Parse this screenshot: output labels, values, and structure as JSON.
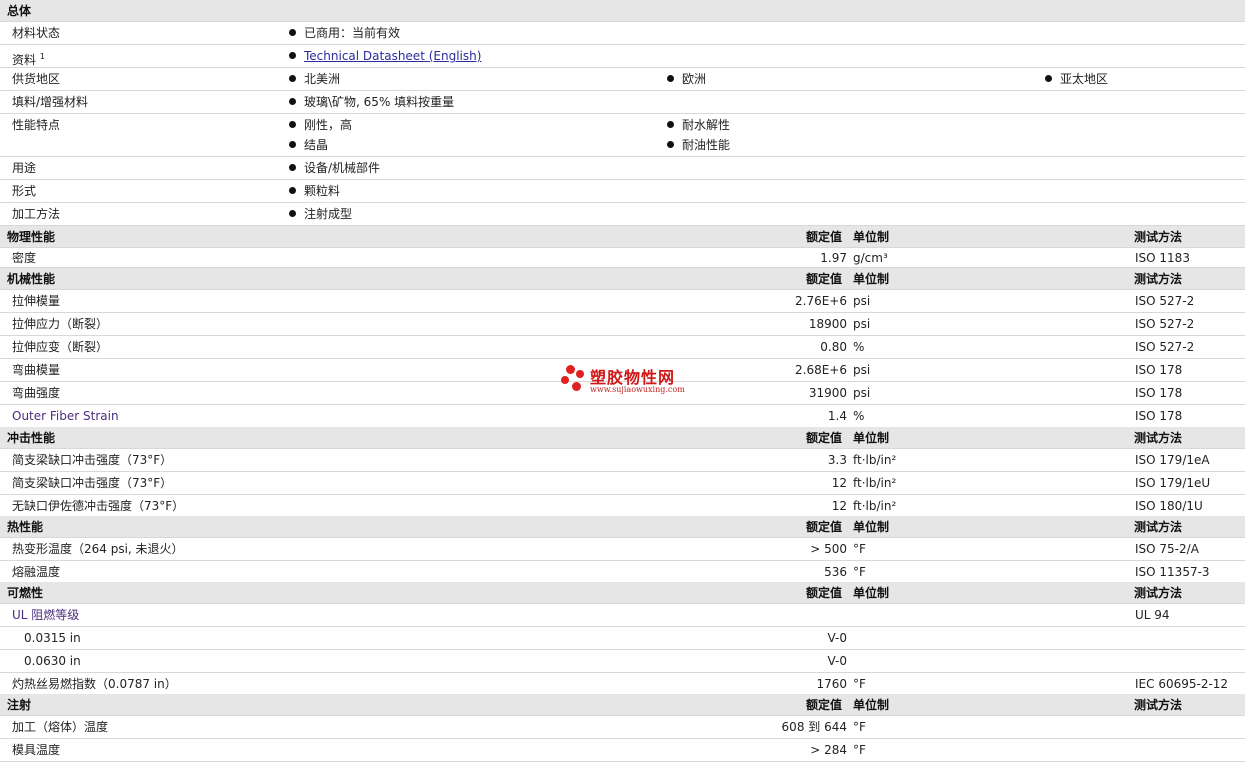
{
  "general": {
    "title": "总体",
    "status_label": "材料状态",
    "status_value": "已商用：当前有效",
    "docs_label": "资料",
    "docs_sup": "1",
    "docs_link": "Technical Datasheet (English)",
    "region_label": "供货地区",
    "regions": [
      "北美洲",
      "欧洲",
      "亚太地区"
    ],
    "filler_label": "填料/增强材料",
    "filler_value": "玻璃\\矿物, 65% 填料按重量",
    "features_label": "性能特点",
    "features": [
      "刚性，高",
      "耐水解性",
      "结晶",
      "耐油性能"
    ],
    "uses_label": "用途",
    "uses_value": "设备/机械部件",
    "form_label": "形式",
    "form_value": "颗粒料",
    "processing_label": "加工方法",
    "processing_value": "注射成型"
  },
  "headers": {
    "nominal": "额定值",
    "unit": "单位制",
    "method": "测试方法"
  },
  "physical": {
    "title": "物理性能",
    "rows": [
      {
        "name": "密度",
        "value": "1.97",
        "unit": "g/cm³",
        "method": "ISO 1183"
      }
    ]
  },
  "mechanical": {
    "title": "机械性能",
    "rows": [
      {
        "name": "拉伸模量",
        "value": "2.76E+6",
        "unit": "psi",
        "method": "ISO 527-2"
      },
      {
        "name": "拉伸应力（断裂）",
        "value": "18900",
        "unit": "psi",
        "method": "ISO 527-2"
      },
      {
        "name": "拉伸应变（断裂）",
        "value": "0.80",
        "unit": "%",
        "method": "ISO 527-2"
      },
      {
        "name": "弯曲模量",
        "value": "2.68E+6",
        "unit": "psi",
        "method": "ISO 178"
      },
      {
        "name": "弯曲强度",
        "value": "31900",
        "unit": "psi",
        "method": "ISO 178"
      },
      {
        "name": "Outer Fiber Strain",
        "value": "1.4",
        "unit": "%",
        "method": "ISO 178"
      }
    ]
  },
  "impact": {
    "title": "冲击性能",
    "rows": [
      {
        "name": "简支梁缺口冲击强度（73°F）",
        "value": "3.3",
        "unit": "ft·lb/in²",
        "method": "ISO 179/1eA"
      },
      {
        "name": "简支梁缺口冲击强度（73°F）",
        "value": "12",
        "unit": "ft·lb/in²",
        "method": "ISO 179/1eU"
      },
      {
        "name": "无缺口伊佐德冲击强度（73°F）",
        "value": "12",
        "unit": "ft·lb/in²",
        "method": "ISO 180/1U"
      }
    ]
  },
  "thermal": {
    "title": "热性能",
    "rows": [
      {
        "name": "热变形温度（264 psi, 未退火）",
        "value": "> 500",
        "unit": "°F",
        "method": "ISO 75-2/A"
      },
      {
        "name": "熔融温度",
        "value": "536",
        "unit": "°F",
        "method": "ISO 11357-3"
      }
    ]
  },
  "flammability": {
    "title": "可燃性",
    "rows": [
      {
        "name": "UL 阻燃等级",
        "value": "",
        "unit": "",
        "method": "UL 94"
      },
      {
        "name": "0.0315 in",
        "value": "V-0",
        "unit": "",
        "method": ""
      },
      {
        "name": "0.0630 in",
        "value": "V-0",
        "unit": "",
        "method": ""
      },
      {
        "name": "灼热丝易燃指数（0.0787 in）",
        "value": "1760",
        "unit": "°F",
        "method": "IEC 60695-2-12"
      }
    ]
  },
  "injection": {
    "title": "注射",
    "rows": [
      {
        "name": "加工（熔体）温度",
        "value": "608 到 644",
        "unit": "°F",
        "method": ""
      },
      {
        "name": "模具温度",
        "value": "> 284",
        "unit": "°F",
        "method": ""
      }
    ]
  },
  "watermark": {
    "name": "塑胶物性网",
    "url": "www.sujiaowuxing.com"
  }
}
